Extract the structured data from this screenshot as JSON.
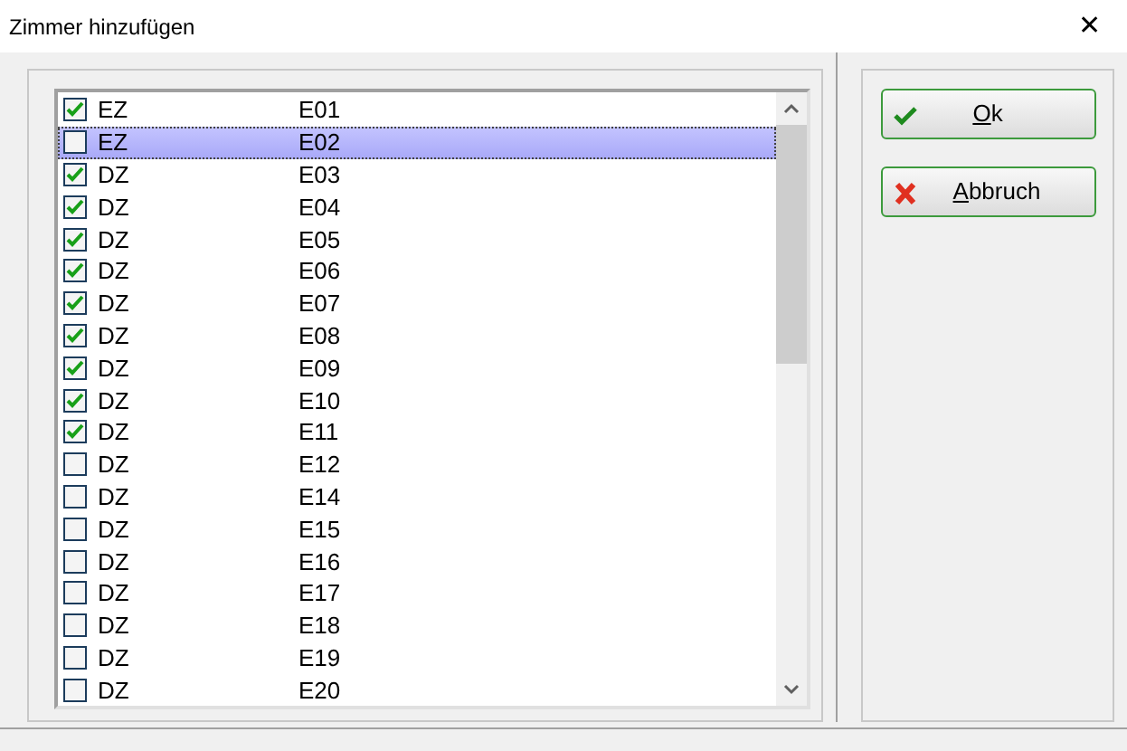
{
  "window": {
    "title": "Zimmer hinzufügen",
    "close": "✕"
  },
  "rooms": [
    {
      "type": "EZ",
      "room": "E01",
      "checked": true,
      "selected": false
    },
    {
      "type": "EZ",
      "room": "E02",
      "checked": false,
      "selected": true
    },
    {
      "type": "DZ",
      "room": "E03",
      "checked": true,
      "selected": false
    },
    {
      "type": "DZ",
      "room": "E04",
      "checked": true,
      "selected": false
    },
    {
      "type": "DZ",
      "room": "E05",
      "checked": true,
      "selected": false
    },
    {
      "type": "DZ",
      "room": "E06",
      "checked": true,
      "selected": false
    },
    {
      "type": "DZ",
      "room": "E07",
      "checked": true,
      "selected": false
    },
    {
      "type": "DZ",
      "room": "E08",
      "checked": true,
      "selected": false
    },
    {
      "type": "DZ",
      "room": "E09",
      "checked": true,
      "selected": false
    },
    {
      "type": "DZ",
      "room": "E10",
      "checked": true,
      "selected": false
    },
    {
      "type": "DZ",
      "room": "E11",
      "checked": true,
      "selected": false
    },
    {
      "type": "DZ",
      "room": "E12",
      "checked": false,
      "selected": false
    },
    {
      "type": "DZ",
      "room": "E14",
      "checked": false,
      "selected": false
    },
    {
      "type": "DZ",
      "room": "E15",
      "checked": false,
      "selected": false
    },
    {
      "type": "DZ",
      "room": "E16",
      "checked": false,
      "selected": false
    },
    {
      "type": "DZ",
      "room": "E17",
      "checked": false,
      "selected": false
    },
    {
      "type": "DZ",
      "room": "E18",
      "checked": false,
      "selected": false
    },
    {
      "type": "DZ",
      "room": "E19",
      "checked": false,
      "selected": false
    },
    {
      "type": "DZ",
      "room": "E20",
      "checked": false,
      "selected": false
    }
  ],
  "buttons": [
    {
      "label": "Ok",
      "kind": "ok"
    },
    {
      "label": "Abbruch",
      "kind": "cancel"
    }
  ]
}
